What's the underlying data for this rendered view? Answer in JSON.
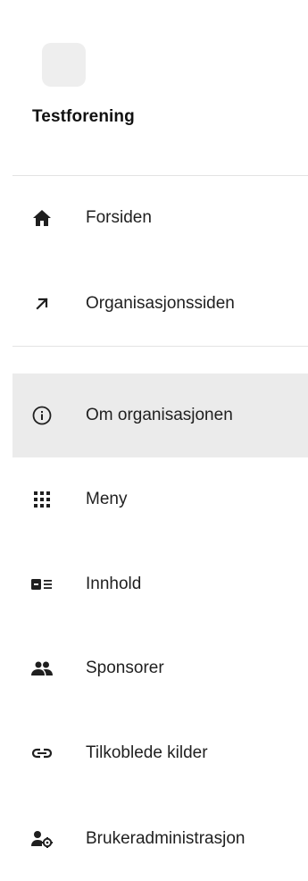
{
  "organization": {
    "name": "Testforening"
  },
  "nav": {
    "primary": [
      {
        "label": "Forsiden",
        "icon": "home-icon"
      },
      {
        "label": "Organisasjonssiden",
        "icon": "arrow-up-right-icon"
      }
    ],
    "secondary": [
      {
        "label": "Om organisasjonen",
        "icon": "info-icon",
        "active": true
      },
      {
        "label": "Meny",
        "icon": "grid-dots-icon"
      },
      {
        "label": "Innhold",
        "icon": "content-list-icon"
      },
      {
        "label": "Sponsorer",
        "icon": "people-icon"
      },
      {
        "label": "Tilkoblede kilder",
        "icon": "link-icon"
      },
      {
        "label": "Brukeradministrasjon",
        "icon": "user-settings-icon"
      }
    ]
  },
  "colors": {
    "active_background": "#ebebeb",
    "icon_color": "#1f1f1f",
    "logo_placeholder": "#eeeeee",
    "divider": "#e3e3e3"
  }
}
